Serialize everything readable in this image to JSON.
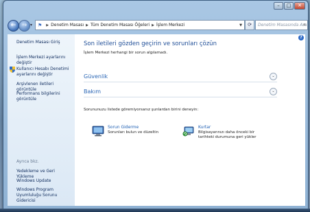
{
  "window": {
    "controls": {
      "minimize": "–",
      "maximize": "□",
      "close": "✕"
    }
  },
  "nav": {
    "back_icon": "←",
    "forward_icon": "→",
    "breadcrumb": [
      "Denetim Masası",
      "Tüm Denetim Masası Öğeleri",
      "İşlem Merkezi"
    ],
    "search_placeholder": "Denetim Masasında Ara"
  },
  "sidebar": {
    "top_items": [
      "Denetim Masası Giriş",
      "İşlem Merkezi ayarlarını değiştir",
      "Kullanıcı Hesabı Denetimi ayarlarını değiştir",
      "Arşivlenen iletileri görüntüle",
      "Performans bilgilerini görüntüle"
    ],
    "see_also_heading": "Ayrıca bkz.",
    "see_also_items": [
      "Yedekleme ve Geri Yükleme",
      "Windows Update",
      "Windows Program Uyumluluğu Sorunu Gidericisi"
    ]
  },
  "main": {
    "title": "Son iletileri gözden geçirin ve sorunları çözün",
    "subtitle": "İşlem Merkezi herhangi bir sorun algılamadı.",
    "sections": [
      "Güvenlik",
      "Bakım"
    ],
    "prompt": "Sorununuzu listede göremiyorsanız şunlardan birini deneyin:",
    "tools": [
      {
        "title": "Sorun Giderme",
        "desc": "Sorunları bulun ve düzeltin"
      },
      {
        "title": "Kurtar",
        "desc": "Bilgisayarınızı daha önceki bir tarihteki durumuna geri yükler"
      }
    ]
  },
  "colors": {
    "link": "#1e5fb3",
    "title": "#1e4d97",
    "sidebar_bg": "#e4eef8"
  }
}
